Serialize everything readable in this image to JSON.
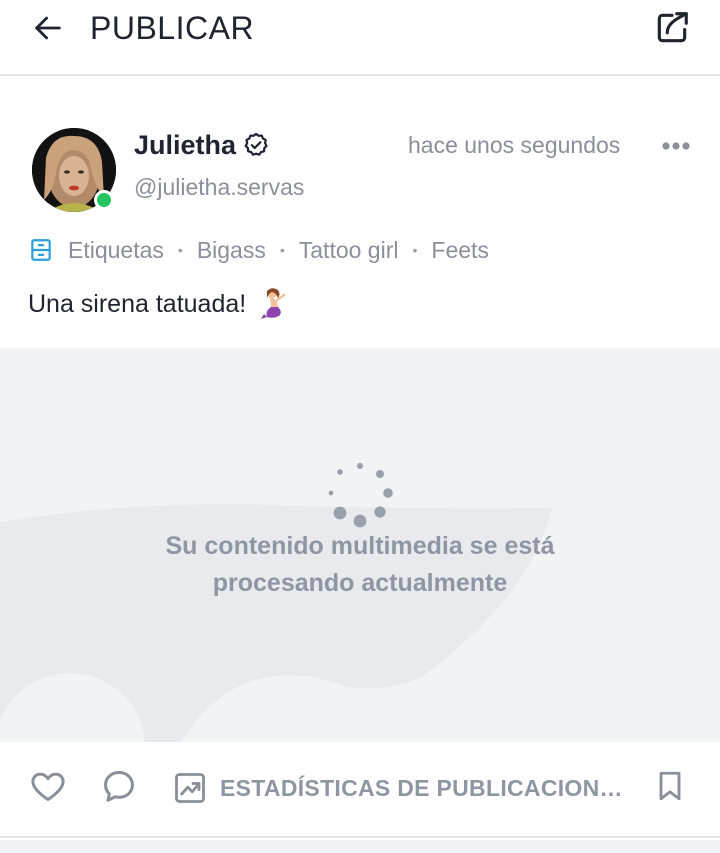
{
  "header": {
    "title": "PUBLICAR",
    "back_icon": "arrow-left-icon",
    "share_icon": "share-icon"
  },
  "post": {
    "user": {
      "name": "Julietha",
      "handle": "@julietha.servas",
      "verified": true,
      "online": true,
      "online_color": "#22c55e"
    },
    "timestamp": "hace unos segundos",
    "tags_label": "Etiquetas",
    "tags": [
      "Bigass",
      "Tattoo girl",
      "Feets"
    ],
    "caption": "Una sirena tatuada!",
    "caption_emoji": "mermaid-emoji"
  },
  "media": {
    "status_text": "Su contenido multimedia se está procesando actualmente"
  },
  "actions": {
    "stats_label": "ESTADÍSTICAS DE PUBLICACION…"
  },
  "colors": {
    "accent_blue": "#2a9fd8",
    "muted_text": "#8a8f99",
    "media_bg": "#f2f3f5"
  }
}
